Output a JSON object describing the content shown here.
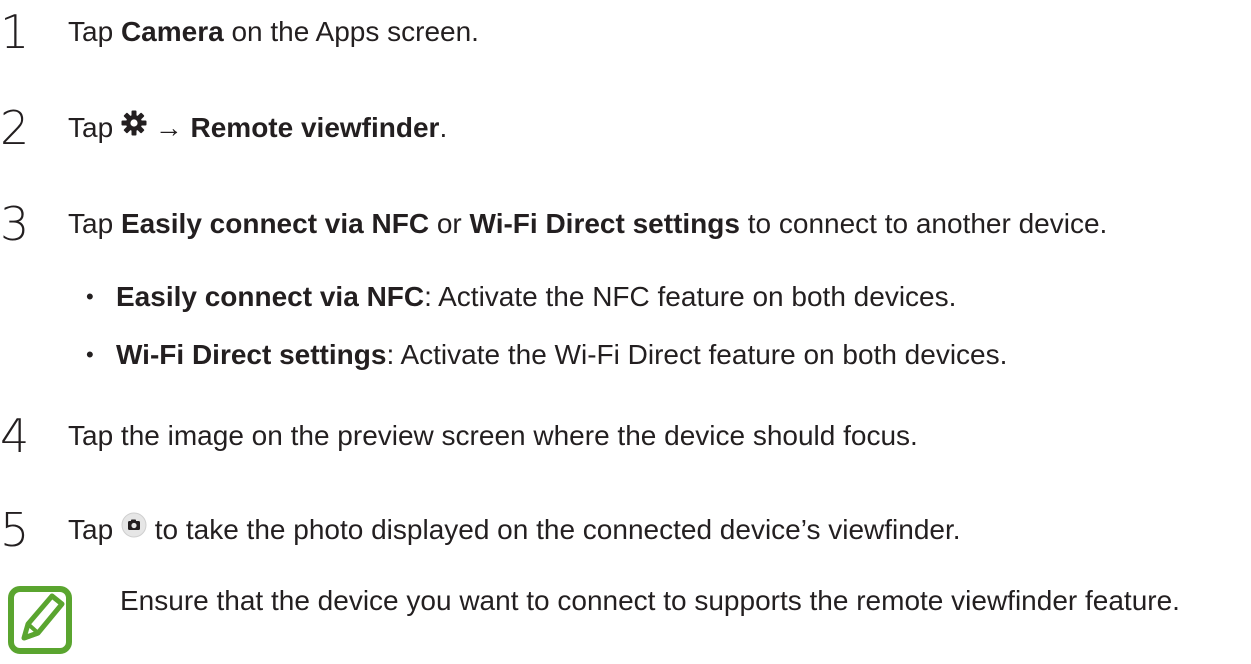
{
  "steps": [
    {
      "num": "1",
      "pre": "Tap ",
      "bold": "Camera",
      "post": " on the Apps screen."
    },
    {
      "num": "2",
      "pre": "Tap ",
      "icon": "gear-icon",
      "arrow": " → ",
      "bold": "Remote viewfinder",
      "post": "."
    },
    {
      "num": "3",
      "pre": "Tap ",
      "bold1": "Easily connect via NFC",
      "mid": " or ",
      "bold2": "Wi-Fi Direct settings",
      "post": " to connect to another device."
    },
    {
      "num": "4",
      "text": "Tap the image on the preview screen where the device should focus."
    },
    {
      "num": "5",
      "pre": "Tap ",
      "icon": "camera-shutter-icon",
      "post": " to take the photo displayed on the connected device’s viewfinder."
    }
  ],
  "bullets": [
    {
      "dot": "•",
      "bold": "Easily connect via NFC",
      "text": ": Activate the NFC feature on both devices."
    },
    {
      "dot": "•",
      "bold": "Wi-Fi Direct settings",
      "text": ": Activate the Wi-Fi Direct feature on both devices."
    }
  ],
  "note": {
    "icon": "note-pencil-icon",
    "text": "Ensure that the device you want to connect to supports the remote viewfinder feature."
  },
  "colors": {
    "text": "#231f20",
    "note_icon_green": "#5aa52f"
  }
}
